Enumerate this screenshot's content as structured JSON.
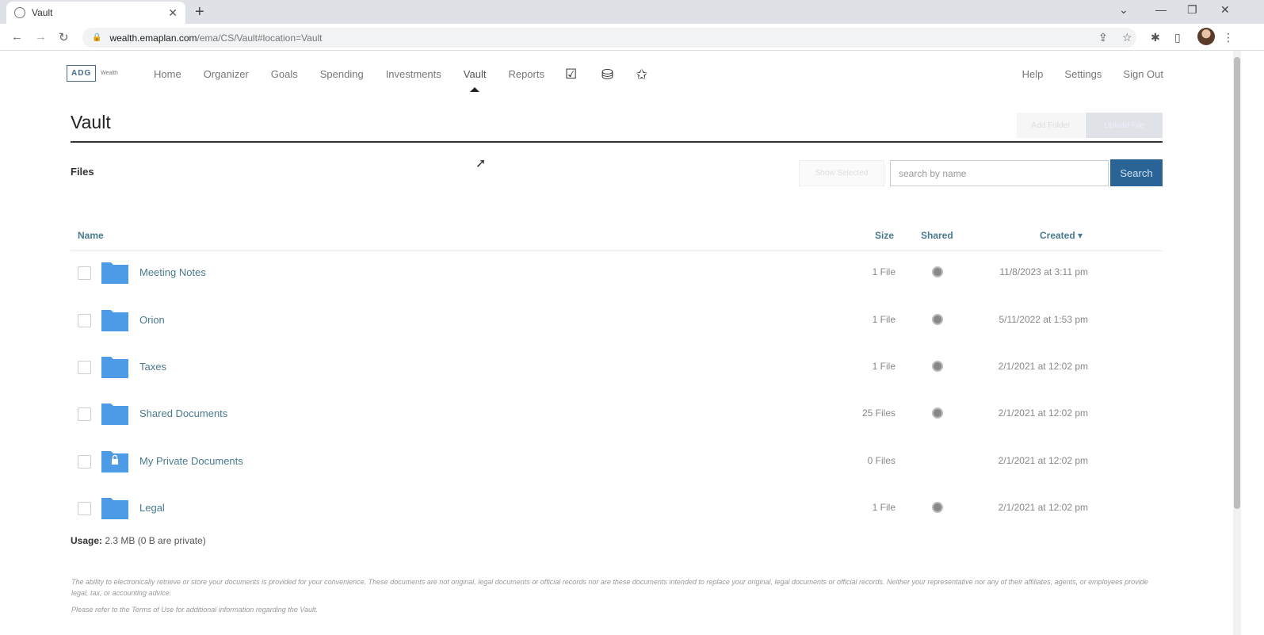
{
  "browser": {
    "tab_title": "Vault",
    "tab_close": "✕",
    "new_tab": "+",
    "url_host": "wealth.emaplan.com",
    "url_path": "/ema/CS/Vault#location=Vault",
    "win_min": "—",
    "win_max": "❐",
    "win_close": "✕",
    "chevron": "⌄"
  },
  "app": {
    "logo_text": "ADG",
    "logo_sub": "Wealth",
    "nav": [
      "Home",
      "Organizer",
      "Goals",
      "Spending",
      "Investments",
      "Vault",
      "Reports"
    ],
    "right_nav": [
      "Help",
      "Settings",
      "Sign Out"
    ]
  },
  "page": {
    "title": "Vault",
    "header_btn1": "Add Folder",
    "header_btn2": "Upload File",
    "files_label": "Files",
    "filter_btn": "Show Selected",
    "search_placeholder": "search by name",
    "search_btn": "Search"
  },
  "table": {
    "headers": {
      "name": "Name",
      "size": "Size",
      "shared": "Shared",
      "created": "Created ▾"
    },
    "rows": [
      {
        "name": "Meeting Notes",
        "size": "1 File",
        "shared": true,
        "created": "11/8/2023 at 3:11 pm",
        "private": false
      },
      {
        "name": "Orion",
        "size": "1 File",
        "shared": true,
        "created": "5/11/2022 at 1:53 pm",
        "private": false
      },
      {
        "name": "Taxes",
        "size": "1 File",
        "shared": true,
        "created": "2/1/2021 at 12:02 pm",
        "private": false
      },
      {
        "name": "Shared Documents",
        "size": "25 Files",
        "shared": true,
        "created": "2/1/2021 at 12:02 pm",
        "private": false
      },
      {
        "name": "My Private Documents",
        "size": "0 Files",
        "shared": false,
        "created": "2/1/2021 at 12:02 pm",
        "private": true
      },
      {
        "name": "Legal",
        "size": "1 File",
        "shared": true,
        "created": "2/1/2021 at 12:02 pm",
        "private": false
      }
    ]
  },
  "usage": {
    "label": "Usage:",
    "value": "2.3 MB (0 B are private)"
  },
  "disclaimer": "The ability to electronically retrieve or store your documents is provided for your convenience. These documents are not original, legal documents or official records nor are these documents intended to replace your original, legal documents or official records. Neither your representative nor any of their affiliates, agents, or employees provide legal, tax, or accounting advice.",
  "disclaimer2": "Please refer to the Terms of Use for additional information regarding the Vault.",
  "colors": {
    "folder": "#4d9be6",
    "accent": "#2a6496",
    "link": "#4a7a90"
  }
}
